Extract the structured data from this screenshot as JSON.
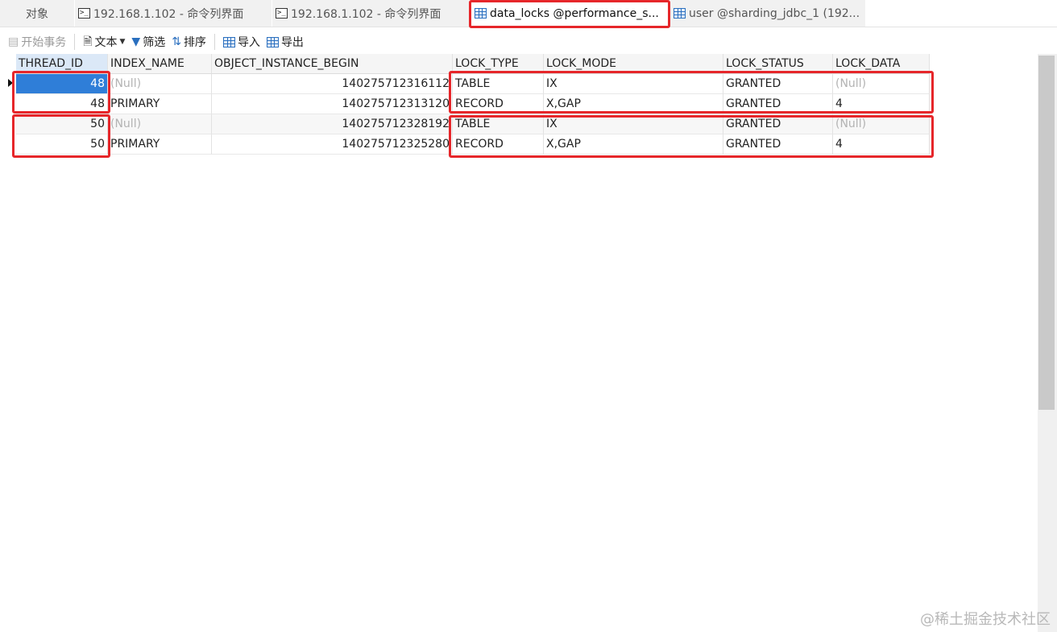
{
  "tabs": [
    {
      "label": "对象",
      "icon": "none",
      "active": false
    },
    {
      "label": "192.168.1.102 - 命令列界面",
      "icon": "terminal-icon",
      "active": false
    },
    {
      "label": "192.168.1.102 - 命令列界面",
      "icon": "terminal-icon",
      "active": false
    },
    {
      "label": "data_locks @performance_s...",
      "icon": "table-icon",
      "active": true
    },
    {
      "label": "user @sharding_jdbc_1 (192...",
      "icon": "table-icon",
      "active": false
    }
  ],
  "toolbar": {
    "begin_transaction": "开始事务",
    "text": "文本",
    "filter": "筛选",
    "sort": "排序",
    "import": "导入",
    "export": "导出"
  },
  "grid": {
    "columns": [
      "THREAD_ID",
      "INDEX_NAME",
      "OBJECT_INSTANCE_BEGIN",
      "LOCK_TYPE",
      "LOCK_MODE",
      "LOCK_STATUS",
      "LOCK_DATA"
    ],
    "rows": [
      [
        "48",
        "(Null)",
        "140275712316112",
        "TABLE",
        "IX",
        "GRANTED",
        "(Null)"
      ],
      [
        "48",
        "PRIMARY",
        "140275712313120",
        "RECORD",
        "X,GAP",
        "GRANTED",
        "4"
      ],
      [
        "50",
        "(Null)",
        "140275712328192",
        "TABLE",
        "IX",
        "GRANTED",
        "(Null)"
      ],
      [
        "50",
        "PRIMARY",
        "140275712325280",
        "RECORD",
        "X,GAP",
        "GRANTED",
        "4"
      ]
    ]
  },
  "colors": {
    "highlight": "#e6262a",
    "selection": "#2f7ed8",
    "null_text": "#b3b3b3"
  },
  "watermark": "@稀土掘金技术社区"
}
